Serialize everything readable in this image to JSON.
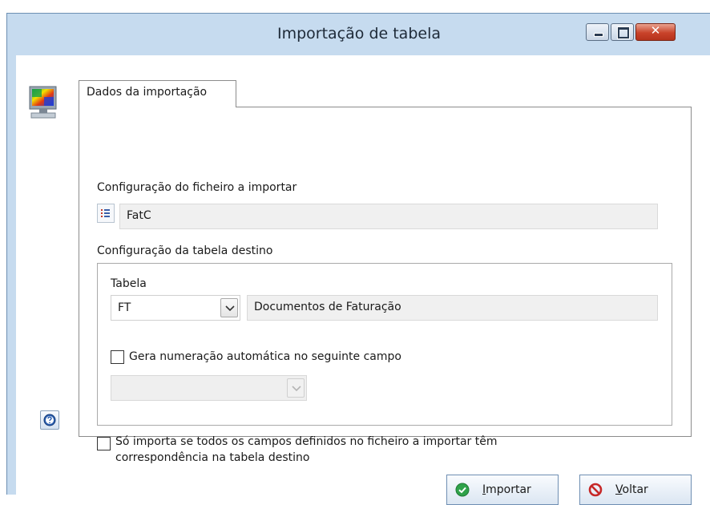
{
  "window": {
    "title": "Importação de tabela",
    "controls": {
      "minimize": "minimize",
      "maximize": "maximize",
      "close": "✕"
    }
  },
  "tab": {
    "label": "Dados da importação"
  },
  "file_config": {
    "label": "Configuração do ficheiro a importar",
    "value": "FatC"
  },
  "dest_config": {
    "label": "Configuração da tabela destino",
    "table_label": "Tabela",
    "table_code": "FT",
    "table_name": "Documentos de Faturação",
    "auto_numbering_label": "Gera numeração automática no seguinte campo",
    "auto_numbering_checked": false,
    "auto_numbering_field": ""
  },
  "only_import": {
    "line1": "Só importa se todos os campos definidos no ficheiro a importar têm",
    "line2": "correspondência na tabela destino",
    "checked": false
  },
  "buttons": {
    "import_mnemonic": "I",
    "import_rest": "mportar",
    "back_mnemonic": "V",
    "back_rest": "oltar"
  },
  "colors": {
    "accent": "#6f8fb3",
    "window_frame": "#c6dbef",
    "ok_green": "#2fa24a",
    "cancel_red": "#c62828"
  },
  "icons": {
    "window": "monitor-icon",
    "help": "help-icon",
    "list": "list-icon",
    "import": "check-circle-icon",
    "back": "no-entry-icon"
  }
}
